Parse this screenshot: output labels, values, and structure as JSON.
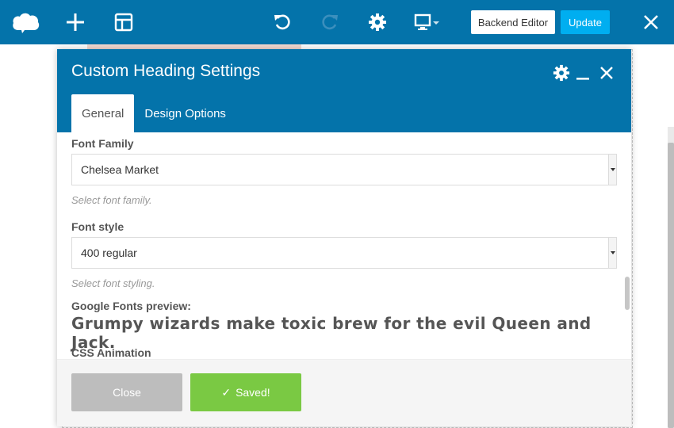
{
  "toolbar": {
    "backend_editor_label": "Backend Editor",
    "update_label": "Update",
    "icons": {
      "logo": "cloud-logo-icon",
      "add": "plus-icon",
      "templates": "layout-icon",
      "undo": "undo-icon",
      "redo": "redo-icon",
      "settings": "gear-icon",
      "responsive": "monitor-icon",
      "close": "close-icon"
    }
  },
  "modal": {
    "title": "Custom Heading Settings",
    "tabs": [
      {
        "label": "General",
        "active": true
      },
      {
        "label": "Design Options",
        "active": false
      }
    ],
    "fields": {
      "font_family": {
        "label": "Font Family",
        "value": "Chelsea Market",
        "help": "Select font family."
      },
      "font_style": {
        "label": "Font style",
        "value": "400 regular",
        "help": "Select font styling."
      },
      "preview": {
        "label": "Google Fonts preview:",
        "text": "Grumpy wizards make toxic brew for the evil Queen and Jack."
      },
      "css_animation": {
        "label": "CSS Animation"
      }
    },
    "footer": {
      "close_label": "Close",
      "saved_label": "Saved!"
    }
  },
  "colors": {
    "primary_blue": "#0473aa",
    "update_blue": "#00aef0",
    "saved_green": "#7ac943",
    "close_gray": "#bdbdbd"
  }
}
